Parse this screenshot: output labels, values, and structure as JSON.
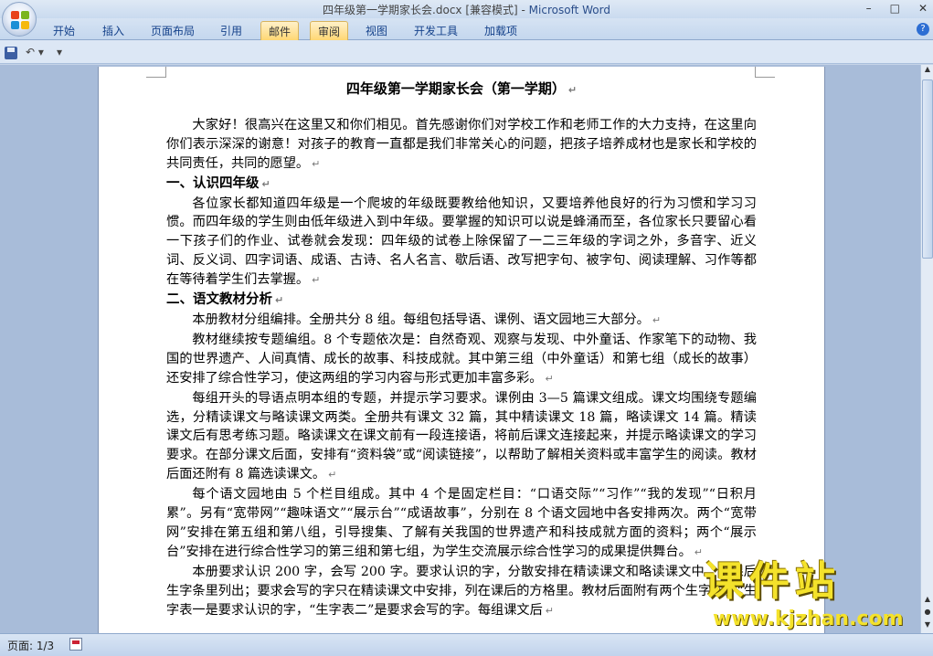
{
  "window": {
    "title_doc": "四年级第一学期家长会.docx [兼容模式] - ",
    "title_app": "Microsoft Word",
    "minimize": "–",
    "maximize": "□",
    "close": "✕"
  },
  "ribbon": {
    "tabs": [
      "开始",
      "插入",
      "页面布局",
      "引用",
      "邮件",
      "审阅",
      "视图",
      "开发工具",
      "加载项"
    ],
    "highlighted_tabs": [
      "邮件",
      "审阅"
    ],
    "help": "?"
  },
  "qat": {
    "save_icon": "save-icon",
    "undo": "↶ ▾",
    "customize": "▾"
  },
  "document": {
    "title": "四年级第一学期家长会（第一学期）",
    "paragraph_mark": "↵",
    "blocks": [
      {
        "type": "p",
        "text": "大家好！很高兴在这里又和你们相见。首先感谢你们对学校工作和老师工作的大力支持，在这里向你们表示深深的谢意！对孩子的教育一直都是我们非常关心的问题，把孩子培养成材也是家长和学校的共同责任，共同的愿望。"
      },
      {
        "type": "h",
        "text": "一、认识四年级"
      },
      {
        "type": "p",
        "text": "各位家长都知道四年级是一个爬坡的年级既要教给他知识，又要培养他良好的行为习惯和学习习惯。而四年级的学生则由低年级进入到中年级。要掌握的知识可以说是蜂涌而至，各位家长只要留心看一下孩子们的作业、试卷就会发现：四年级的试卷上除保留了一二三年级的字词之外，多音字、近义词、反义词、四字词语、成语、古诗、名人名言、歇后语、改写把字句、被字句、阅读理解、习作等都在等待着学生们去掌握。"
      },
      {
        "type": "h",
        "text": "二、语文教材分析"
      },
      {
        "type": "p",
        "text": "本册教材分组编排。全册共分 8 组。每组包括导语、课例、语文园地三大部分。"
      },
      {
        "type": "p",
        "text": "教材继续按专题编组。8 个专题依次是：自然奇观、观察与发现、中外童话、作家笔下的动物、我国的世界遗产、人间真情、成长的故事、科技成就。其中第三组（中外童话）和第七组（成长的故事）还安排了综合性学习，使这两组的学习内容与形式更加丰富多彩。"
      },
      {
        "type": "p",
        "text": "每组开头的导语点明本组的专题，并提示学习要求。课例由 3—5 篇课文组成。课文均围绕专题编选，分精读课文与略读课文两类。全册共有课文 32 篇，其中精读课文 18 篇，略读课文 14 篇。精读课文后有思考练习题。略读课文在课文前有一段连接语，将前后课文连接起来，并提示略读课文的学习要求。在部分课文后面，安排有“资料袋”或“阅读链接”，以帮助了解相关资料或丰富学生的阅读。教材后面还附有 8 篇选读课文。"
      },
      {
        "type": "p",
        "text": "每个语文园地由 5 个栏目组成。其中 4 个是固定栏目：“口语交际”“习作”“我的发现”“日积月累”。另有“宽带网”“趣味语文”“展示台”“成语故事”，分别在 8 个语文园地中各安排两次。两个“宽带网”安排在第五组和第八组，引导搜集、了解有关我国的世界遗产和科技成就方面的资料；两个“展示台”安排在进行综合性学习的第三组和第七组，为学生交流展示综合性学习的成果提供舞台。"
      },
      {
        "type": "p",
        "text": "本册要求认识 200 字，会写 200 字。要求认识的字，分散安排在精读课文和略读课文中，在课后生字条里列出；要求会写的字只在精读课文中安排，列在课后的方格里。教材后面附有两个生字表，“生字表一是要求认识的字，“生字表二”是要求会写的字。每组课文后"
      }
    ]
  },
  "status": {
    "page": "页面: 1/3"
  },
  "watermark": {
    "title": "课件站",
    "url": "www.kjzhan.com"
  }
}
